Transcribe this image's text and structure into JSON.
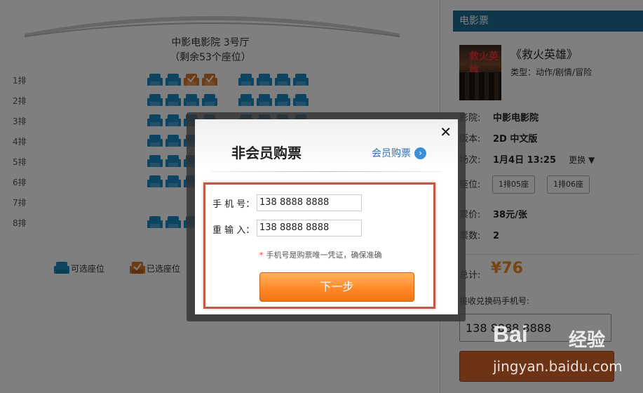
{
  "seatmap": {
    "hall_name": "中影电影院 3号厅",
    "seats_left": "（剩余53个座位）",
    "rows": [
      "1排",
      "2排",
      "3排",
      "4排",
      "5排",
      "6排",
      "7排",
      "8排"
    ],
    "legend": {
      "available": "可选座位",
      "selected": "已选座位"
    }
  },
  "panel": {
    "header": "电影票",
    "movie_title": "《救火英雄》",
    "movie_type": "类型：动作/剧情/冒险",
    "poster_text": "救火英雄",
    "cinema_label": "影院:",
    "cinema": "中影电影院",
    "version_label": "版本:",
    "version": "2D 中文版",
    "session_label": "场次:",
    "session": "1月4日  13:25",
    "change": "更换",
    "change_arrow": "▼",
    "seats_label": "座位:",
    "seat_chips": [
      "1排05座",
      "1排06座"
    ],
    "price_label": "票价:",
    "price": "38元/张",
    "count_label": "票数:",
    "count": "2",
    "total_label": "总计:",
    "total": "¥76",
    "phone_prompt": "接收兑换码手机号:",
    "phone_value": "138 8888 8888"
  },
  "dialog": {
    "title": "非会员购票",
    "member_link": "会员购票",
    "close": "✕",
    "phone_label": "手 机 号：",
    "phone_value": "138 8888 8888",
    "reenter_label": "重 输 入：",
    "reenter_value": "138 8888 8888",
    "hint_star": "*",
    "hint": "手机号是购票唯一凭证，确保准确",
    "next_button": "下一步"
  },
  "watermark": {
    "logo": "Bai",
    "logo_cn": "经验",
    "url": "jingyan.baidu.com"
  },
  "colors": {
    "seat_available": "#1b89c4",
    "seat_selected": "#d97a2a",
    "header": "#1f6e97",
    "accent": "#f08a1c"
  }
}
